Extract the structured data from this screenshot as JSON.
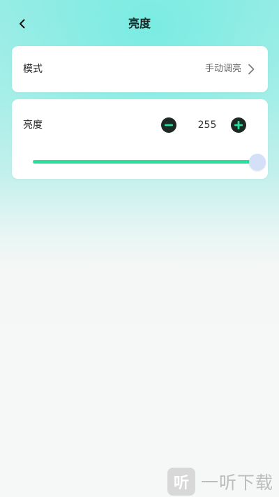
{
  "header": {
    "title": "亮度",
    "back_icon": "chevron-left-icon"
  },
  "mode": {
    "label": "模式",
    "value": "手动调亮",
    "chevron_icon": "chevron-right-icon"
  },
  "brightness": {
    "label": "亮度",
    "value": "255",
    "minus_icon": "minus-circle-icon",
    "plus_icon": "plus-circle-icon",
    "slider_level_fraction": 1.0
  },
  "watermark": {
    "logo_text": "听",
    "text": "一听下载"
  },
  "colors": {
    "accent": "#26e09e",
    "icon_dark": "#1d2a24",
    "thumb": "#d3e0f8"
  }
}
